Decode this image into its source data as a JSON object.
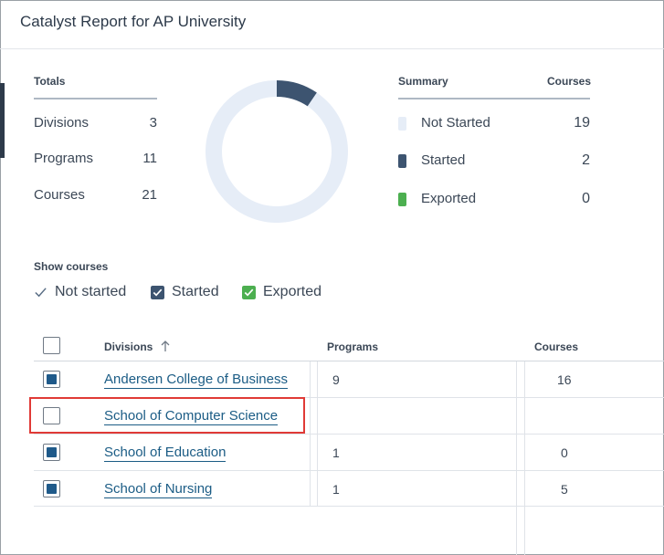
{
  "window": {
    "title": "Catalyst Report for AP University"
  },
  "totals": {
    "header": "Totals",
    "rows": [
      {
        "label": "Divisions",
        "value": "3"
      },
      {
        "label": "Programs",
        "value": "11"
      },
      {
        "label": "Courses",
        "value": "21"
      }
    ]
  },
  "summary": {
    "header": "Summary",
    "courses_header": "Courses",
    "rows": [
      {
        "label": "Not Started",
        "value": "19",
        "color": "#e6edf7"
      },
      {
        "label": "Started",
        "value": "2",
        "color": "#3d5470"
      },
      {
        "label": "Exported",
        "value": "0",
        "color": "#4caf50"
      }
    ]
  },
  "donut": {
    "not_started": 19,
    "started": 2,
    "exported": 0,
    "colors": {
      "not_started": "#e6edf7",
      "started": "#3d5470",
      "exported": "#4caf50"
    }
  },
  "filters": {
    "title": "Show courses",
    "items": [
      {
        "label": "Not started",
        "checked": true,
        "style": "check"
      },
      {
        "label": "Started",
        "checked": true,
        "style": "dark"
      },
      {
        "label": "Exported",
        "checked": true,
        "style": "green"
      }
    ]
  },
  "table": {
    "headers": {
      "divisions": "Divisions",
      "programs": "Programs",
      "courses": "Courses",
      "sort_icon": "arrow-up-icon"
    },
    "rows": [
      {
        "name": "Andersen College of Business",
        "programs": "9",
        "courses": "16",
        "checked": true
      },
      {
        "name": "School of Computer Science",
        "programs": "",
        "courses": "",
        "checked": false
      },
      {
        "name": "School of Education",
        "programs": "1",
        "courses": "0",
        "checked": true
      },
      {
        "name": "School of Nursing",
        "programs": "1",
        "courses": "5",
        "checked": true
      }
    ]
  },
  "accent": {
    "highlight": "#e03a36",
    "link": "#1b5c85"
  }
}
